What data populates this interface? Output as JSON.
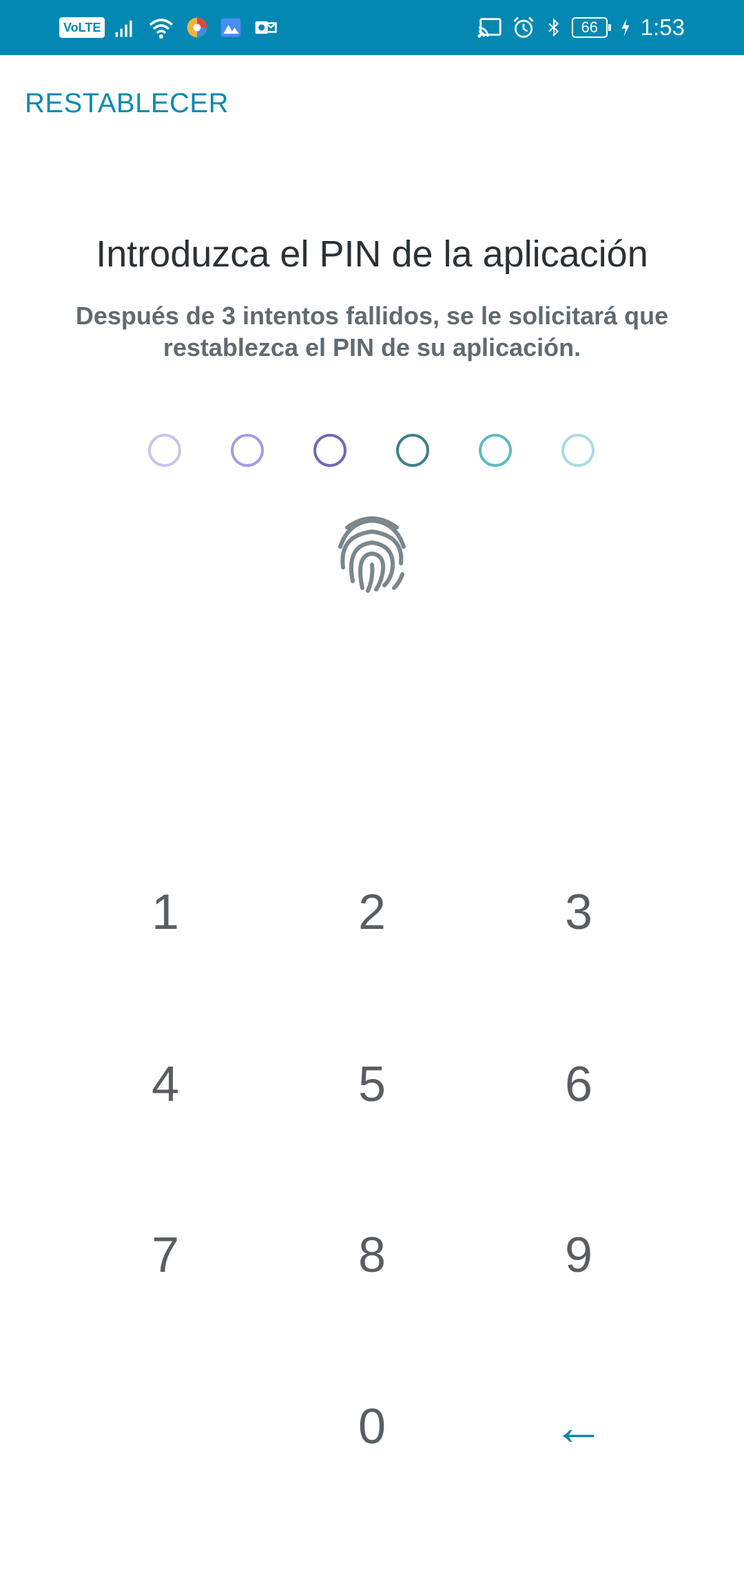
{
  "status_bar": {
    "volte": "VoLTE",
    "battery": "66",
    "time": "1:53",
    "background": "#0288b2",
    "left_icons": [
      "volte-icon",
      "signal-icon",
      "wifi-icon",
      "browser-app-icon",
      "photos-app-icon",
      "outlook-app-icon"
    ],
    "right_icons": [
      "cast-icon",
      "alarm-icon",
      "bluetooth-icon",
      "battery-icon",
      "charging-icon"
    ]
  },
  "header": {
    "reset_label": "RESTABLECER"
  },
  "main": {
    "title": "Introduzca el PIN de la aplicación",
    "subtitle": "Después de 3 intentos fallidos, se le solicitará que restablezca el PIN de su aplicación."
  },
  "pin": {
    "length": 6,
    "filled": 0,
    "dot_colors": [
      "#c7c4ec",
      "#a19ce6",
      "#6f69b6",
      "#3f7f8c",
      "#5fb9c9",
      "#a9dce3"
    ]
  },
  "fingerprint": {
    "icon": "fingerprint-icon",
    "color": "#7a878c"
  },
  "keypad": {
    "keys": [
      "1",
      "2",
      "3",
      "4",
      "5",
      "6",
      "7",
      "8",
      "9",
      "",
      "0",
      "←"
    ],
    "digit_color": "#5a5e62",
    "accent": "#0a8ab1"
  }
}
